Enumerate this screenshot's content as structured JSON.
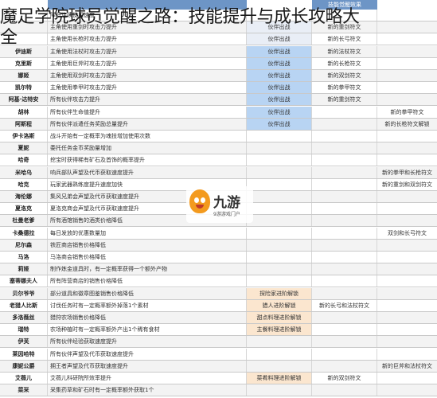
{
  "title_line1": "魔足学院球员觉醒之路：技能提升与成长攻略大",
  "title_line2": "全",
  "header_label": "技能觉醒效果",
  "logo": {
    "brand": "九游",
    "sub": "9游游戏门户"
  },
  "rows": [
    {
      "name": "",
      "desc": "降低连续使用速度",
      "c2": "",
      "c3": "",
      "c4": "",
      "hl": ""
    },
    {
      "name": "",
      "desc": "主角使用重剑时攻击力提升",
      "c2": "伙伴出战",
      "c3": "新的重剑符文",
      "c4": "",
      "hl": "lite"
    },
    {
      "name": "",
      "desc": "主角使用长枪时攻击力提升",
      "c2": "伙伴出战",
      "c3": "新的长弓符文",
      "c4": "",
      "hl": "lite"
    },
    {
      "name": "伊迪斯",
      "desc": "主角使用法杖时攻击力提升",
      "c2": "伙伴出战",
      "c3": "新的法杖符文",
      "c4": "",
      "hl": "blue"
    },
    {
      "name": "克里斯",
      "desc": "主角使用巨斧时攻击力提升",
      "c2": "伙伴出战",
      "c3": "新的长枪符文",
      "c4": "",
      "hl": "blue"
    },
    {
      "name": "娜姬",
      "desc": "主角使用双剑时攻击力提升",
      "c2": "伙伴出战",
      "c3": "新的双剑符文",
      "c4": "",
      "hl": "blue"
    },
    {
      "name": "凯尔特",
      "desc": "主角使用拳甲时攻击力提升",
      "c2": "伙伴出战",
      "c3": "新的拳甲符文",
      "c4": "",
      "hl": "blue"
    },
    {
      "name": "阿基·达特安",
      "desc": "所有伙伴攻击力提升",
      "c2": "伙伴出战",
      "c3": "新的重剑符文",
      "c4": "",
      "hl": "blue"
    },
    {
      "name": "胡林",
      "desc": "所有伙伴生命值提升",
      "c2": "伙伴出战",
      "c3": "",
      "c4": "新的拳甲符文",
      "hl": "blue"
    },
    {
      "name": "阿斯程",
      "desc": "所有伙伴派遣任务奖励总量提升",
      "c2": "伙伴出战",
      "c3": "",
      "c4": "新的长枪符文解锁",
      "hl": "blue"
    },
    {
      "name": "伊卡洛斯",
      "desc": "战斗开始有一定概率为魂技增加使用次数",
      "c2": "",
      "c3": "",
      "c4": "",
      "hl": ""
    },
    {
      "name": "夏妮",
      "desc": "委托任务金币奖励量增加",
      "c2": "",
      "c3": "",
      "c4": "",
      "hl": ""
    },
    {
      "name": "哈奇",
      "desc": "挖宝时获得稀有矿石及首饰的概率提升",
      "c2": "",
      "c3": "",
      "c4": "",
      "hl": ""
    },
    {
      "name": "米哈乌",
      "desc": "响兵部队声望及代币获取速度提升",
      "c2": "",
      "c3": "",
      "c4": "新的拳甲和长枪符文",
      "hl": ""
    },
    {
      "name": "哈克",
      "desc": "玩家武器熟练度提升速度加快",
      "c2": "",
      "c3": "",
      "c4": "新的重剑和双剑符文",
      "hl": ""
    },
    {
      "name": "海伦娜",
      "desc": "集风兄弟会声望及代币获取速度提升",
      "c2": "",
      "c3": "",
      "c4": "",
      "hl": ""
    },
    {
      "name": "夏洛克",
      "desc": "夏洛克商会声望及代币获取速度提升",
      "c2": "",
      "c3": "",
      "c4": "",
      "hl": ""
    },
    {
      "name": "杜曼老爹",
      "desc": "所有酒馆销售的酒类价格降低",
      "c2": "",
      "c3": "",
      "c4": "",
      "hl": ""
    },
    {
      "name": "卡桑德拉",
      "desc": "每日发放的优惠数量加",
      "c2": "",
      "c3": "",
      "c4": "双剑和长弓符文",
      "hl": ""
    },
    {
      "name": "尼尔森",
      "desc": "铁匠商店销售价格降低",
      "c2": "",
      "c3": "",
      "c4": "",
      "hl": ""
    },
    {
      "name": "马洛",
      "desc": "马洛商会销售价格降低",
      "c2": "",
      "c3": "",
      "c4": "",
      "hl": ""
    },
    {
      "name": "莉娅",
      "desc": "制作炼金道具时，有一定概率获得一个额外产物",
      "c2": "",
      "c3": "",
      "c4": "",
      "hl": ""
    },
    {
      "name": "塞蒂娜夫人",
      "desc": "所有阵营商店的销售价格降低",
      "c2": "",
      "c3": "",
      "c4": "",
      "hl": ""
    },
    {
      "name": "贝尔爷爷",
      "desc": "部分道具和徽章图鉴销售价格降低",
      "c2": "探险家进阶解锁",
      "c3": "",
      "c4": "",
      "hl": "orange"
    },
    {
      "name": "老猎人比斯",
      "desc": "讨伐任务时有一定概率额外掉落1个素材",
      "c2": "猎人进阶解锁",
      "c3": "新的长弓和法杖符文",
      "c4": "",
      "hl": "orange"
    },
    {
      "name": "多洛薇丝",
      "desc": "猎狩农场销售价格降低",
      "c2": "甜点料理进阶解锁",
      "c3": "",
      "c4": "",
      "hl": "orange"
    },
    {
      "name": "瑞特",
      "desc": "农场种植时有一定概率额外产出1个稀有食材",
      "c2": "主餐料理进阶解锁",
      "c3": "",
      "c4": "",
      "hl": "orange"
    },
    {
      "name": "伊芙",
      "desc": "所有伙伴经验获取速度提升",
      "c2": "",
      "c3": "",
      "c4": "",
      "hl": ""
    },
    {
      "name": "莱因哈特",
      "desc": "所有伙伴声望及代币获取速度提升",
      "c2": "",
      "c3": "",
      "c4": "",
      "hl": ""
    },
    {
      "name": "康妮公爵",
      "desc": "拥王者声望及代币获取速度提升",
      "c2": "",
      "c3": "",
      "c4": "新的巨斧和法杖符文",
      "hl": ""
    },
    {
      "name": "艾薇儿",
      "desc": "艾薇儿科研院所效率提升",
      "c2": "菜肴料理进阶解锁",
      "c3": "新的双剑符文",
      "c4": "",
      "hl": "orange"
    },
    {
      "name": "菜采",
      "desc": "采集药草和矿石时有一定概率额外获取1个",
      "c2": "",
      "c3": "",
      "c4": "",
      "hl": ""
    }
  ]
}
